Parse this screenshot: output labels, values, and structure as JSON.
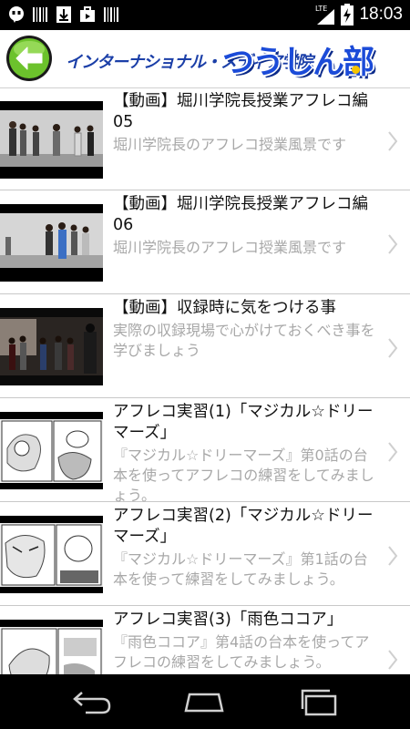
{
  "status_bar": {
    "time": "18:03",
    "network": "LTE",
    "icons": [
      "hangouts-icon",
      "barcode-icon",
      "download-icon",
      "briefcase-icon",
      "barcode-icon"
    ]
  },
  "header": {
    "logo_text": "インターナショナル・メディア学院",
    "logo_mark": "つうしん部"
  },
  "items": [
    {
      "title": "【動画】堀川学院長授業アフレコ編05",
      "description": "堀川学院長のアフレコ授業風景です"
    },
    {
      "title": "【動画】堀川学院長授業アフレコ編06",
      "description": "堀川学院長のアフレコ授業風景です"
    },
    {
      "title": "【動画】収録時に気をつける事",
      "description": "実際の収録現場で心がけておくべき事を学びましょう"
    },
    {
      "title": "アフレコ実習(1)「マジカル☆ドリーマーズ」",
      "description": "『マジカル☆ドリーマーズ』第0話の台本を使ってアフレコの練習をしてみましょう。"
    },
    {
      "title": "アフレコ実習(2)「マジカル☆ドリーマーズ」",
      "description": "『マジカル☆ドリーマーズ』第1話の台本を使って練習をしてみましょう。"
    },
    {
      "title": "アフレコ実習(3)「雨色ココア」",
      "description": "『雨色ココア』第4話の台本を使ってアフレコの練習をしてみましょう。"
    }
  ]
}
